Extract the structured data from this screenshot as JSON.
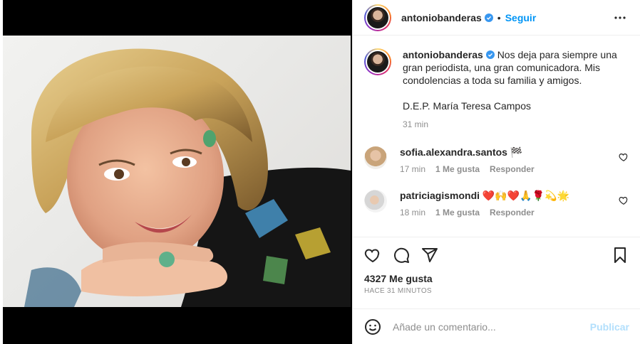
{
  "post": {
    "author": "antoniobanderas",
    "follow_label": "Seguir",
    "separator": "•",
    "caption": "Nos deja para siempre una gran periodista, una gran comunicadora. Mis condolencias a toda su familia y amigos.",
    "caption_rip": "D.E.P. María Teresa Campos",
    "caption_time": "31 min",
    "likes": "4327 Me gusta",
    "time_ago": "HACE 31 MINUTOS"
  },
  "comments": [
    {
      "user": "sofia.alexandra.santos",
      "text": "🏁",
      "time": "17 min",
      "likes": "1 Me gusta",
      "reply": "Responder"
    },
    {
      "user": "patriciagismondi",
      "text": "❤️🙌❤️🙏🌹💫🌟",
      "time": "18 min",
      "likes": "1 Me gusta",
      "reply": "Responder"
    }
  ],
  "add_comment": {
    "placeholder": "Añade un comentario...",
    "publish_label": "Publicar"
  },
  "icons": {
    "verified": "verified-badge-icon",
    "more": "more-options-icon",
    "like": "heart-icon",
    "comment": "comment-icon",
    "share": "share-icon",
    "save": "bookmark-icon",
    "emoji": "emoji-icon"
  },
  "colors": {
    "accent": "#0095f6",
    "publish_disabled": "#b2dffc",
    "muted": "#8e8e8e",
    "text": "#262626"
  }
}
